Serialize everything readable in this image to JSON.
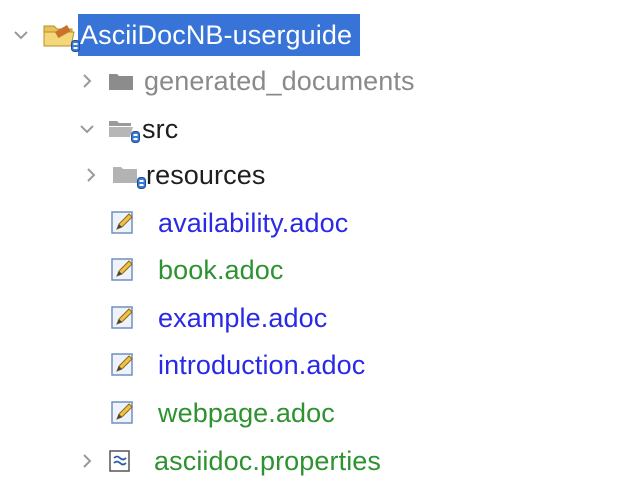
{
  "tree": {
    "root": {
      "label": "AsciiDocNB-userguide",
      "expanded": true,
      "selected": true
    },
    "items": [
      {
        "label": "generated_documents",
        "kind": "folder",
        "expanded": false,
        "status": "ignored"
      },
      {
        "label": "src",
        "kind": "folder",
        "expanded": true,
        "status": "normal"
      },
      {
        "label": "resources",
        "kind": "folder",
        "expanded": false,
        "status": "normal"
      },
      {
        "label": "availability.adoc",
        "kind": "file",
        "status": "modified"
      },
      {
        "label": "book.adoc",
        "kind": "file",
        "status": "added"
      },
      {
        "label": "example.adoc",
        "kind": "file",
        "status": "modified"
      },
      {
        "label": "introduction.adoc",
        "kind": "file",
        "status": "modified"
      },
      {
        "label": "webpage.adoc",
        "kind": "file",
        "status": "added"
      },
      {
        "label": "asciidoc.properties",
        "kind": "properties-file",
        "expanded": false,
        "status": "added"
      }
    ]
  },
  "colors": {
    "selection": "#3874d8",
    "modified": "#2929e6",
    "added": "#2e9230",
    "ignored": "#8a8a8a",
    "normal": "#1e1e1e"
  }
}
